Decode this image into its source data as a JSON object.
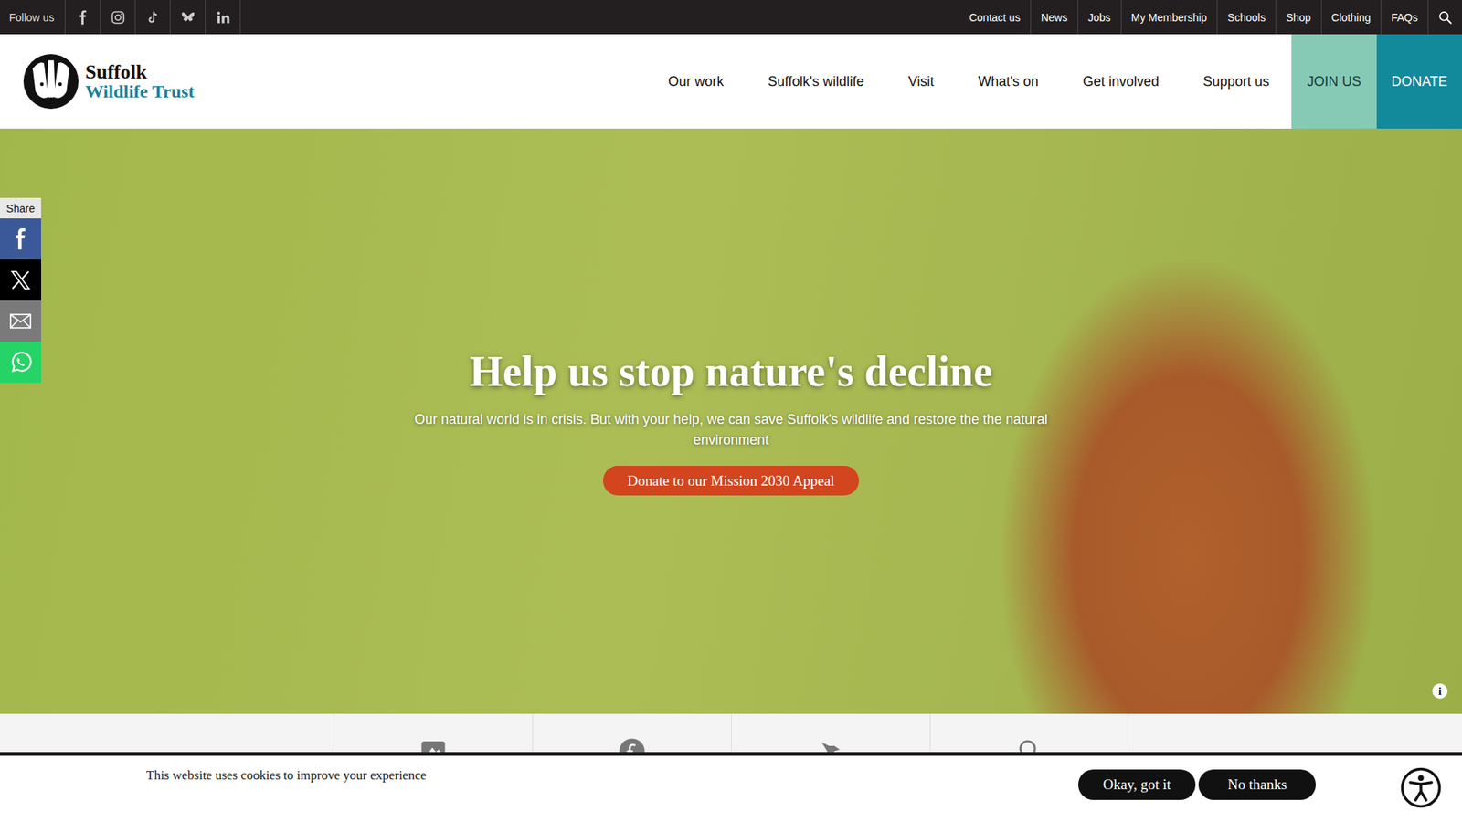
{
  "topbar": {
    "follow_label": "Follow us",
    "social": [
      {
        "kind": "facebook"
      },
      {
        "kind": "instagram"
      },
      {
        "kind": "tiktok"
      },
      {
        "kind": "bluesky"
      },
      {
        "kind": "linkedin"
      }
    ],
    "links": [
      "Contact us",
      "News",
      "Jobs",
      "My Membership",
      "Schools",
      "Shop",
      "Clothing",
      "FAQs"
    ]
  },
  "logo": {
    "line1": "Suffolk",
    "line2": "Wildlife Trust"
  },
  "nav": [
    "Our work",
    "Suffolk's wildlife",
    "Visit",
    "What's on",
    "Get involved",
    "Support us"
  ],
  "nav_cta": [
    {
      "label": "JOIN US",
      "color": "#86cab5"
    },
    {
      "label": "DONATE",
      "color": "#13899c"
    }
  ],
  "hero": {
    "title": "Help us stop nature's decline",
    "subtitle": "Our natural world is in crisis. But with your help, we can save Suffolk's wildlife and restore the the natural environment",
    "button": "Donate to our Mission 2030 Appeal",
    "info": "i"
  },
  "share": {
    "label": "Share",
    "buttons": [
      {
        "kind": "facebook",
        "color": "#3b5998"
      },
      {
        "kind": "x",
        "color": "#000000"
      },
      {
        "kind": "email",
        "color": "#7a7a7a"
      },
      {
        "kind": "whatsapp",
        "color": "#25d366"
      }
    ]
  },
  "quick_links": [
    {
      "kind": "reserve"
    },
    {
      "kind": "donate"
    },
    {
      "kind": "wildlife"
    },
    {
      "kind": "search"
    }
  ],
  "cookie": {
    "message": "This website uses cookies to improve your experience",
    "buttons": [
      "Okay, got it",
      "No thanks"
    ]
  }
}
